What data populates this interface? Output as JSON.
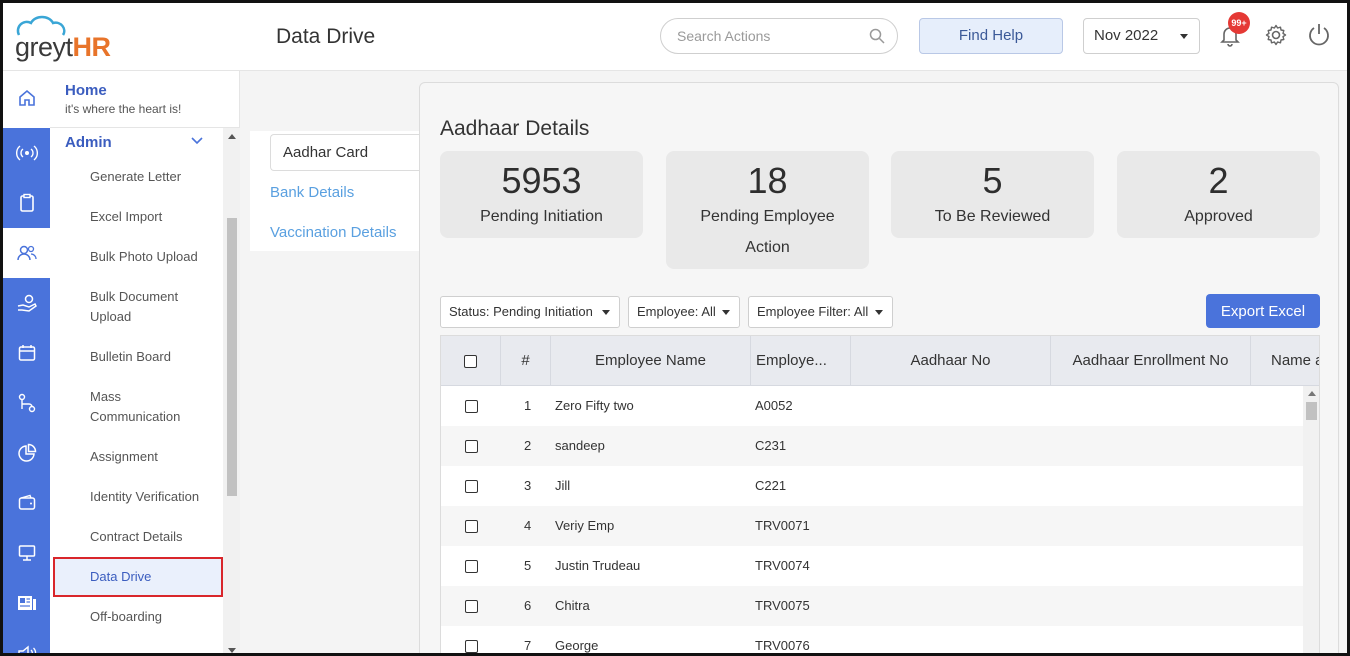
{
  "brand": {
    "logo_plain": "greyt",
    "logo_accent": "HR"
  },
  "header": {
    "page_title": "Data Drive",
    "search_placeholder": "Search Actions",
    "find_help": "Find Help",
    "month": "Nov 2022",
    "notification_badge": "99+"
  },
  "colors": {
    "primary": "#4a73db",
    "link": "#5aa0e0",
    "accent": "#e8742a",
    "badge": "#e53935",
    "active_outline": "#d9262b"
  },
  "rail_icons": [
    "home-icon",
    "broadcast-icon",
    "clipboard-icon",
    "people-icon",
    "hand-coin-icon",
    "calendar-icon",
    "flow-icon",
    "pie-chart-icon",
    "wallet-icon",
    "monitor-icon",
    "news-icon",
    "speaker-icon"
  ],
  "sidebar": {
    "home_title": "Home",
    "home_subtitle": "it's where the heart is!",
    "section_title": "Admin",
    "items": [
      [
        "Generate Letter"
      ],
      [
        "Excel Import"
      ],
      [
        "Bulk Photo Upload"
      ],
      [
        "Bulk Document",
        "Upload"
      ],
      [
        "Bulletin Board"
      ],
      [
        "Mass",
        "Communication"
      ],
      [
        "Assignment"
      ],
      [
        "Identity Verification"
      ],
      [
        "Contract Details"
      ],
      [
        "Data Drive"
      ],
      [
        "Off-boarding"
      ]
    ],
    "active_item": "Data Drive"
  },
  "subnav": {
    "active": "Aadhar Card",
    "items": [
      "Bank Details",
      "Vaccination Details"
    ]
  },
  "panel": {
    "title": "Aadhaar Details",
    "stats": [
      {
        "value": "5953",
        "label": [
          "Pending Initiation"
        ]
      },
      {
        "value": "18",
        "label": [
          "Pending Employee",
          "Action"
        ]
      },
      {
        "value": "5",
        "label": [
          "To Be Reviewed"
        ]
      },
      {
        "value": "2",
        "label": [
          "Approved"
        ]
      }
    ],
    "filters": [
      "Status: Pending Initiation",
      "Employee: All",
      "Employee Filter: All"
    ],
    "export_label": "Export Excel"
  },
  "table": {
    "headers": [
      "#",
      "Employee Name",
      "Employe...",
      "Aadhaar No",
      "Aadhaar Enrollment No",
      "Name a"
    ],
    "rows": [
      {
        "num": "1",
        "name": "Zero Fifty two",
        "id": "A0052"
      },
      {
        "num": "2",
        "name": "sandeep",
        "id": "C231"
      },
      {
        "num": "3",
        "name": "Jill",
        "id": "C221"
      },
      {
        "num": "4",
        "name": "Veriy Emp",
        "id": "TRV0071"
      },
      {
        "num": "5",
        "name": "Justin Trudeau",
        "id": "TRV0074"
      },
      {
        "num": "6",
        "name": "Chitra",
        "id": "TRV0075"
      },
      {
        "num": "7",
        "name": "George",
        "id": "TRV0076"
      }
    ]
  }
}
